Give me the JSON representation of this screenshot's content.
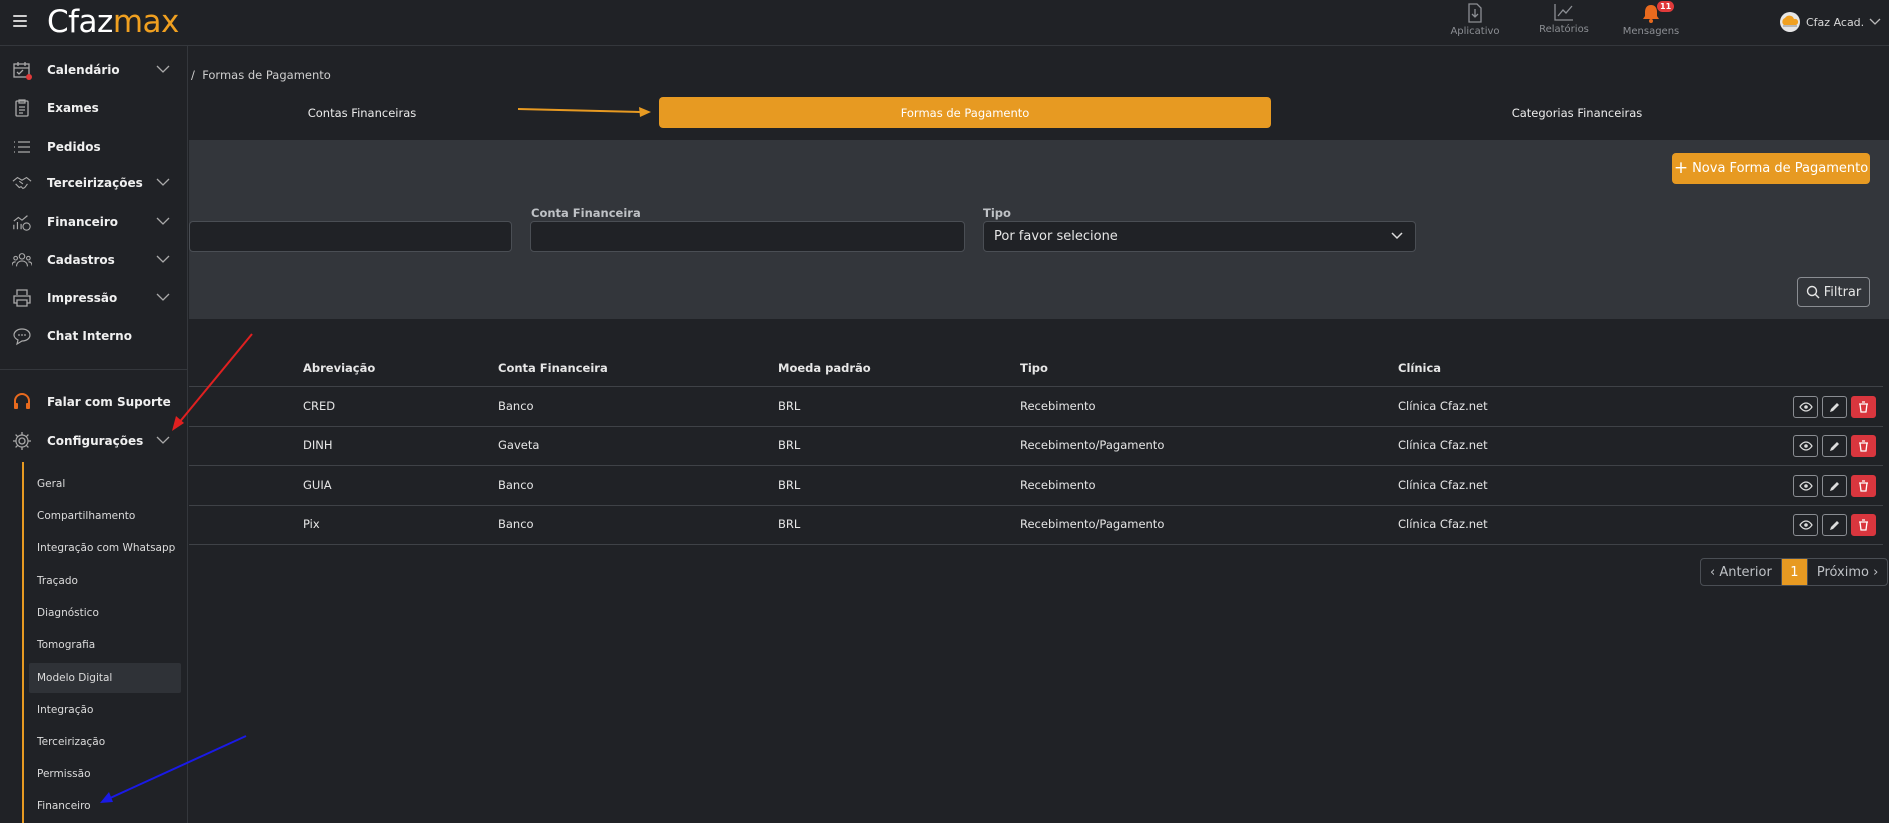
{
  "header": {
    "logo_part1": "Cfaz",
    "logo_part2": "max",
    "items": [
      {
        "label": "Aplicativo",
        "icon": "download-icon"
      },
      {
        "label": "Relatórios",
        "icon": "chart-icon"
      },
      {
        "label": "Mensagens",
        "icon": "bell-icon",
        "badge": "11"
      }
    ],
    "user_name": "Cfaz Acad."
  },
  "sidebar": {
    "items": [
      {
        "label": "Calendário",
        "icon": "calendar-icon"
      },
      {
        "label": "Exames",
        "icon": "clipboard-icon"
      },
      {
        "label": "Pedidos",
        "icon": "list-icon"
      },
      {
        "label": "Terceirizações",
        "icon": "handshake-icon"
      },
      {
        "label": "Financeiro",
        "icon": "finance-icon"
      },
      {
        "label": "Cadastros",
        "icon": "users-icon"
      },
      {
        "label": "Impressão",
        "icon": "printer-icon"
      },
      {
        "label": "Chat Interno",
        "icon": "chat-icon"
      },
      {
        "label": "Falar com Suporte",
        "icon": "headset-icon"
      },
      {
        "label": "Configurações",
        "icon": "gear-icon"
      }
    ],
    "submenu": [
      "Geral",
      "Compartilhamento",
      "Integração com Whatsapp",
      "Traçado",
      "Diagnóstico",
      "Tomografia",
      "Modelo Digital",
      "Integração",
      "Terceirização",
      "Permissão",
      "Financeiro"
    ]
  },
  "breadcrumb": {
    "separator": "/",
    "current": "Formas de Pagamento"
  },
  "tabs": [
    "Contas Financeiras",
    "Formas de Pagamento",
    "Categorias Financeiras"
  ],
  "filters": {
    "new_button": "Nova Forma de Pagamento",
    "conta_label": "Conta Financeira",
    "conta_value": "",
    "tipo_label": "Tipo",
    "tipo_value": "Por favor selecione",
    "filter_button": "Filtrar"
  },
  "table": {
    "headers": [
      "Abreviação",
      "Conta Financeira",
      "Moeda padrão",
      "Tipo",
      "Clínica"
    ],
    "rows": [
      {
        "abrev": "CRED",
        "conta": "Banco",
        "moeda": "BRL",
        "tipo": "Recebimento",
        "clinica": "Clínica Cfaz.net"
      },
      {
        "abrev": "DINH",
        "conta": "Gaveta",
        "moeda": "BRL",
        "tipo": "Recebimento/Pagamento",
        "clinica": "Clínica Cfaz.net"
      },
      {
        "abrev": "GUIA",
        "conta": "Banco",
        "moeda": "BRL",
        "tipo": "Recebimento",
        "clinica": "Clínica Cfaz.net"
      },
      {
        "abrev": "Pix",
        "conta": "Banco",
        "moeda": "BRL",
        "tipo": "Recebimento/Pagamento",
        "clinica": "Clínica Cfaz.net"
      }
    ]
  },
  "pagination": {
    "prev": "‹ Anterior",
    "current": "1",
    "next": "Próximo ›"
  },
  "colors": {
    "accent": "#e79a22",
    "danger": "#d9363e",
    "annotation_red": "#e02020",
    "annotation_blue": "#1a1ae6"
  }
}
